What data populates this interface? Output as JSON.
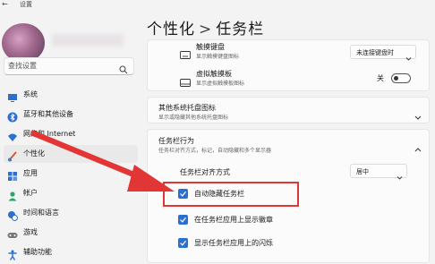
{
  "window": {
    "back_icon": "back-arrow-icon",
    "title": "设置"
  },
  "search": {
    "placeholder": "查找设置",
    "icon": "search-icon"
  },
  "sidebar": {
    "items": [
      {
        "label": "系统",
        "icon": "monitor-icon",
        "color": "#2b6fd0",
        "active": false
      },
      {
        "label": "蓝牙和其他设备",
        "icon": "bluetooth-icon",
        "color": "#2b6fd0",
        "active": false
      },
      {
        "label": "网络和 Internet",
        "icon": "wifi-icon",
        "color": "#2b6fd0",
        "active": false
      },
      {
        "label": "个性化",
        "icon": "brush-icon",
        "color": "#d65a2a",
        "active": true
      },
      {
        "label": "应用",
        "icon": "apps-icon",
        "color": "#2b6fd0",
        "active": false
      },
      {
        "label": "帐户",
        "icon": "person-icon",
        "color": "#2aa36a",
        "active": false
      },
      {
        "label": "时间和语言",
        "icon": "globe-clock-icon",
        "color": "#2b6fd0",
        "active": false
      },
      {
        "label": "游戏",
        "icon": "gamepad-icon",
        "color": "#666666",
        "active": false
      },
      {
        "label": "辅助功能",
        "icon": "accessibility-icon",
        "color": "#2b6fd0",
        "active": false
      }
    ]
  },
  "main": {
    "breadcrumb": {
      "parent": "个性化",
      "separator": ">",
      "current": "任务栏"
    },
    "touch_keyboard": {
      "title": "触摸键盘",
      "desc": "显示触摸键盘图标",
      "value": "未连接键盘时"
    },
    "virtual_touchpad": {
      "title": "虚拟触摸板",
      "desc": "显示虚拟触摸板图标",
      "toggle_label": "关"
    },
    "other_tray": {
      "title": "其他系统托盘图标",
      "desc": "显示或隐藏其他系统托盘图标"
    },
    "taskbar_behaviors": {
      "title": "任务栏行为",
      "desc": "任务栏对齐方式，标记，自动隐藏和多个显示器",
      "alignment_label": "任务栏对齐方式",
      "alignment_value": "居中",
      "options": [
        {
          "label": "自动隐藏任务栏",
          "checked": true
        },
        {
          "label": "在任务栏应用上显示徽章",
          "checked": true
        },
        {
          "label": "显示任务栏应用上的闪烁",
          "checked": true
        }
      ]
    }
  },
  "colors": {
    "accent": "#2b6fd0",
    "annotation": "#e23636"
  }
}
